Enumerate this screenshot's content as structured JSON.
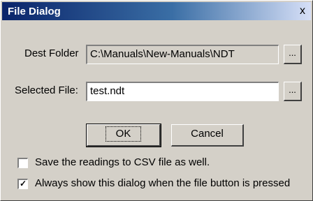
{
  "window": {
    "title": "File Dialog",
    "close_glyph": "x"
  },
  "dest_folder": {
    "label": "Dest Folder",
    "value": "C:\\Manuals\\New-Manuals\\NDT",
    "browse_label": "..."
  },
  "selected_file": {
    "label": "Selected File:",
    "value": "test.ndt",
    "browse_label": "..."
  },
  "buttons": {
    "ok_label": "OK",
    "cancel_label": "Cancel"
  },
  "options": [
    {
      "label": "Save the readings to CSV file as well.",
      "checked": false
    },
    {
      "label": "Always show this dialog when the file button is pressed",
      "checked": true
    }
  ]
}
